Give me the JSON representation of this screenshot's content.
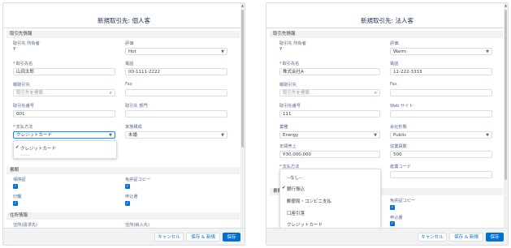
{
  "left": {
    "title": "新規取引先: 個人客",
    "section_account_info": "取引先情報",
    "owner_label": "取引先 所有者",
    "owner_value": "Y",
    "rating_label": "評価",
    "rating_value": "Hot",
    "name_label": "取引先名",
    "name_value": "山田太郎",
    "phone_label": "電話",
    "phone_value": "00-1111-2222",
    "parent_label": "親取引先",
    "parent_placeholder": "取引先を検索...",
    "fax_label": "Fax",
    "number_label": "取引先番号",
    "number_value": "001",
    "dept_label": "取引先 部門",
    "payment_label": "支払方法",
    "payment_value": "クレジットカード",
    "family_label": "家族構成",
    "family_value": "未婚",
    "dropdown_options": [
      "クレジットカード",
      "------"
    ],
    "section_docs": "書類",
    "insurance_label": "保険証",
    "license_copy_label": "免許証コピー",
    "seal_label": "印鑑",
    "receipt_label": "申込書",
    "section_address": "住所情報",
    "billing_label": "住所(請求先)",
    "shipping_label": "住所(納入先)",
    "cancel_label": "キャンセル",
    "save_new_label": "保存 & 新規",
    "save_label": "保存"
  },
  "right": {
    "title": "新規取引先: 法人客",
    "section_account_info": "取引先情報",
    "owner_label": "取引先 所有者",
    "owner_value": "Y",
    "rating_label": "評価",
    "rating_value": "Warm",
    "name_label": "取引先名",
    "name_value": "株式会社A",
    "phone_label": "電話",
    "phone_value": "11-222-3333",
    "parent_label": "親取引先",
    "parent_placeholder": "取引先を検索...",
    "fax_label": "Fax",
    "number_label": "取引先番号",
    "number_value": "111",
    "web_label": "Web サイト",
    "industry_label": "業種",
    "industry_value": "Energy",
    "ownership_label": "会社形態",
    "ownership_value": "Public",
    "revenue_label": "年間売上",
    "revenue_value": "¥30,000,000",
    "employees_label": "従業員数",
    "employees_value": "500",
    "payment_label": "支払方法",
    "site_label": "産業コード",
    "dropdown_options": [
      "--なし--",
      "銀行振込",
      "郵便局・コンビニ支払",
      "口座引落",
      "クレジットカード"
    ],
    "section_docs_partial": "書類",
    "license_copy_label": "免許証コピー",
    "receipt_label": "申込書",
    "cancel_label": "キャンセル",
    "save_new_label": "保存 & 新規",
    "save_label": "保存"
  }
}
